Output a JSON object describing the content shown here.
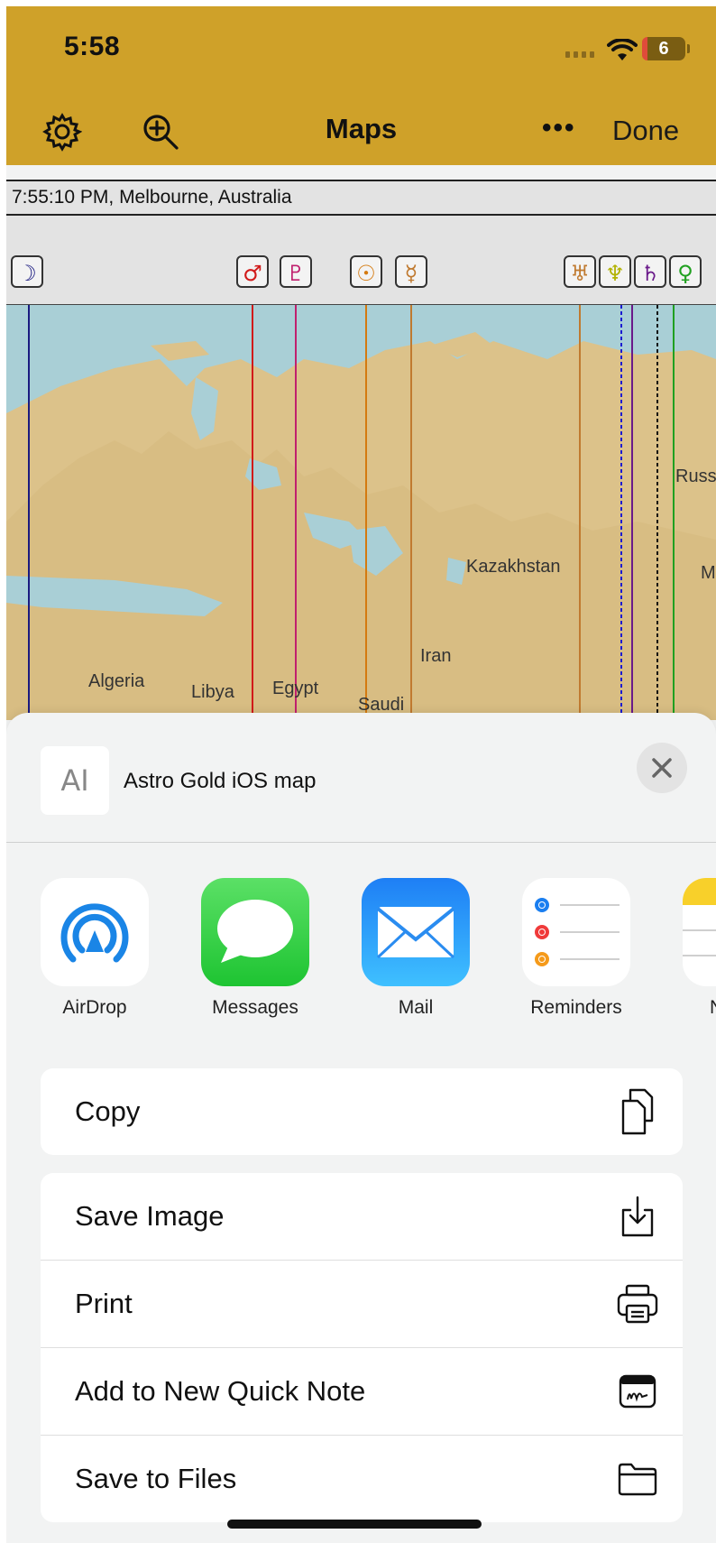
{
  "status": {
    "time": "5:58",
    "battery": "6"
  },
  "nav": {
    "title": "Maps",
    "more": "•••",
    "done": "Done",
    "icons": [
      "gear-icon",
      "zoom-in-icon"
    ]
  },
  "map": {
    "info": "7:55:10 PM, Melbourne, Australia",
    "planets": [
      {
        "glyph": "☽",
        "color": "#1a1a80"
      },
      {
        "glyph": "♂",
        "color": "#d11a1a"
      },
      {
        "glyph": "♇",
        "color": "#c0206e"
      },
      {
        "glyph": "☉",
        "color": "#d47a10"
      },
      {
        "glyph": "☿",
        "color": "#c07a30"
      },
      {
        "glyph": "♅",
        "color": "#c07a30"
      },
      {
        "glyph": "♆",
        "color": "#b2b200"
      },
      {
        "glyph": "♄",
        "color": "#6a1a8a"
      },
      {
        "glyph": "♀",
        "color": "#20a020"
      }
    ],
    "labels": {
      "kazakhstan": "Kazakhstan",
      "russia": "Russ",
      "iran": "Iran",
      "algeria": "Algeria",
      "libya": "Libya",
      "egypt": "Egypt",
      "saudi": "Saudi",
      "mongolia": "M"
    }
  },
  "sheet": {
    "title": "Astro Gold iOS map",
    "doc_icon": "AI",
    "apps": [
      {
        "label": "AirDrop",
        "icon": "airdrop-icon"
      },
      {
        "label": "Messages",
        "icon": "messages-icon"
      },
      {
        "label": "Mail",
        "icon": "mail-icon"
      },
      {
        "label": "Reminders",
        "icon": "reminders-icon"
      },
      {
        "label": "N",
        "icon": "notes-icon"
      }
    ],
    "actions": {
      "copy": "Copy",
      "save_image": "Save Image",
      "print": "Print",
      "quick_note": "Add to New Quick Note",
      "save_files": "Save to Files"
    }
  }
}
